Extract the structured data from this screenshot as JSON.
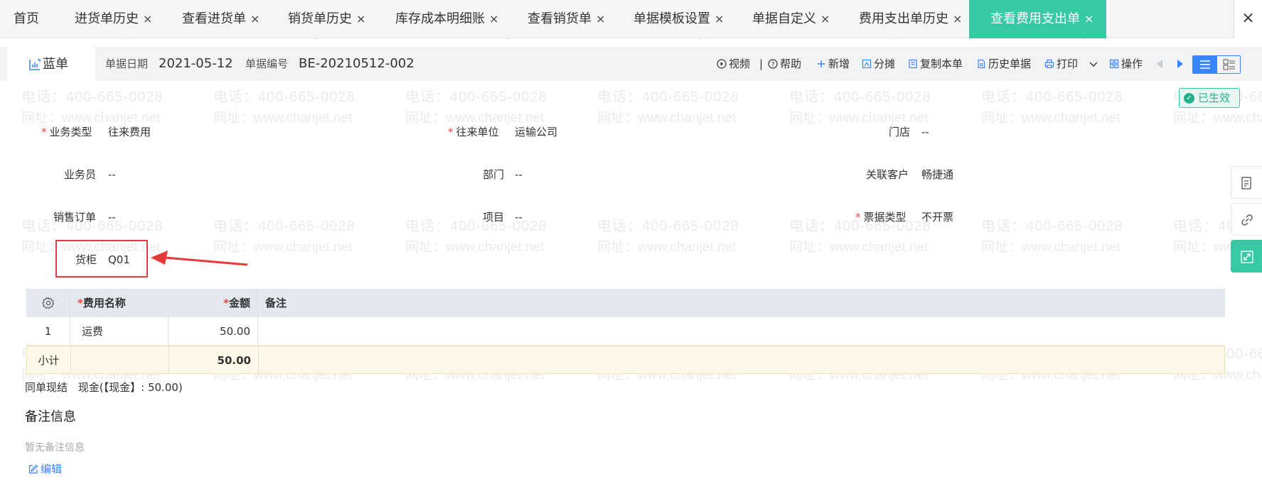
{
  "tabs": [
    {
      "label": "首页",
      "closable": false
    },
    {
      "label": "进货单历史",
      "closable": true
    },
    {
      "label": "查看进货单",
      "closable": true
    },
    {
      "label": "销货单历史",
      "closable": true
    },
    {
      "label": "库存成本明细账",
      "closable": true
    },
    {
      "label": "查看销货单",
      "closable": true
    },
    {
      "label": "单据模板设置",
      "closable": true
    },
    {
      "label": "单据自定义",
      "closable": true
    },
    {
      "label": "费用支出单历史",
      "closable": true
    },
    {
      "label": "查看费用支出单",
      "closable": true,
      "active": true
    }
  ],
  "close_symbol": "×",
  "watermark": {
    "phone": "电话：400-665-0028",
    "site": "网址：www.chanjet.net"
  },
  "header": {
    "doc_tab": "蓝单",
    "date_label": "单据日期",
    "date_value": "2021-05-12",
    "number_label": "单据编号",
    "number_value": "BE-20210512-002"
  },
  "toolbar": {
    "video": "视频",
    "sep": "|",
    "help": "帮助",
    "add": "新增",
    "allocate": "分摊",
    "copy": "复制本单",
    "history": "历史单据",
    "print": "打印",
    "operate": "操作"
  },
  "status": "已生效",
  "form": {
    "business_type": {
      "label": "业务类型",
      "value": "往来费用",
      "required": true
    },
    "partner": {
      "label": "往来单位",
      "value": "运输公司",
      "required": true
    },
    "store": {
      "label": "门店",
      "value": "--"
    },
    "salesman": {
      "label": "业务员",
      "value": "--"
    },
    "department": {
      "label": "部门",
      "value": "--"
    },
    "related_customer": {
      "label": "关联客户",
      "value": "畅捷通"
    },
    "sales_order": {
      "label": "销售订单",
      "value": "--"
    },
    "project": {
      "label": "项目",
      "value": "--"
    },
    "invoice_type": {
      "label": "票据类型",
      "value": "不开票",
      "required": true
    },
    "cabinet": {
      "label": "货柜",
      "value": "Q01"
    }
  },
  "table": {
    "columns": [
      "费用名称",
      "金额",
      "备注"
    ],
    "rows": [
      {
        "index": "1",
        "name": "运费",
        "amount": "50.00",
        "note": ""
      }
    ],
    "subtotal_label": "小计",
    "subtotal_amount": "50.00"
  },
  "summary": {
    "label": "同单现结",
    "value": "现金(【现金】: 50.00)"
  },
  "notes": {
    "title": "备注信息",
    "empty": "暂无备注信息",
    "edit": "编辑"
  },
  "colors": {
    "accent": "#35c9a5",
    "primary": "#3a86ff",
    "required": "#f0443c",
    "highlight": "#e33b3b"
  }
}
